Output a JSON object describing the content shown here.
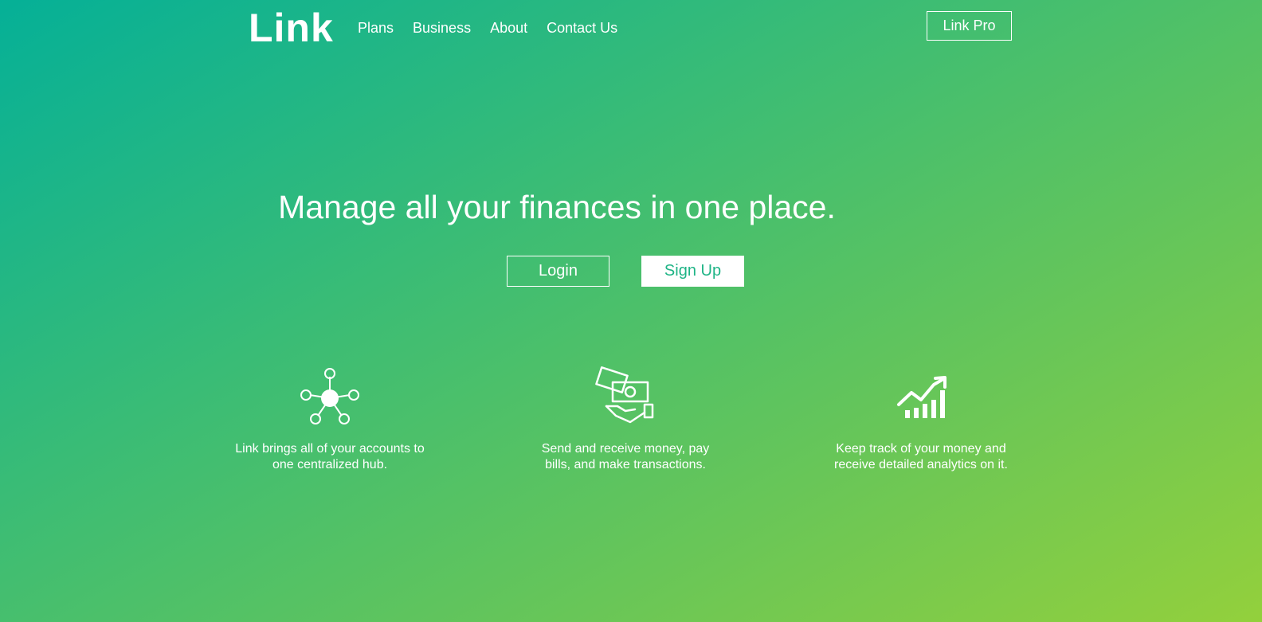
{
  "nav": {
    "logo_text": "Link",
    "links": [
      {
        "label": "Plans"
      },
      {
        "label": "Business"
      },
      {
        "label": "About"
      },
      {
        "label": "Contact Us"
      }
    ],
    "pro_button": "Link Pro"
  },
  "hero": {
    "title": "Manage all your finances in one place.",
    "login_label": "Login",
    "signup_label": "Sign Up"
  },
  "features": [
    {
      "icon": "hub-network-icon",
      "text": "Link brings all of your accounts to one centralized hub."
    },
    {
      "icon": "money-hand-icon",
      "text": "Send and receive money, pay bills, and make transactions."
    },
    {
      "icon": "analytics-chart-icon",
      "text": "Keep track of your money and receive detailed analytics on it."
    }
  ],
  "colors": {
    "gradient_start": "#05b097",
    "gradient_end": "#93d03c",
    "text": "#ffffff",
    "signup_text": "#1fb486"
  }
}
